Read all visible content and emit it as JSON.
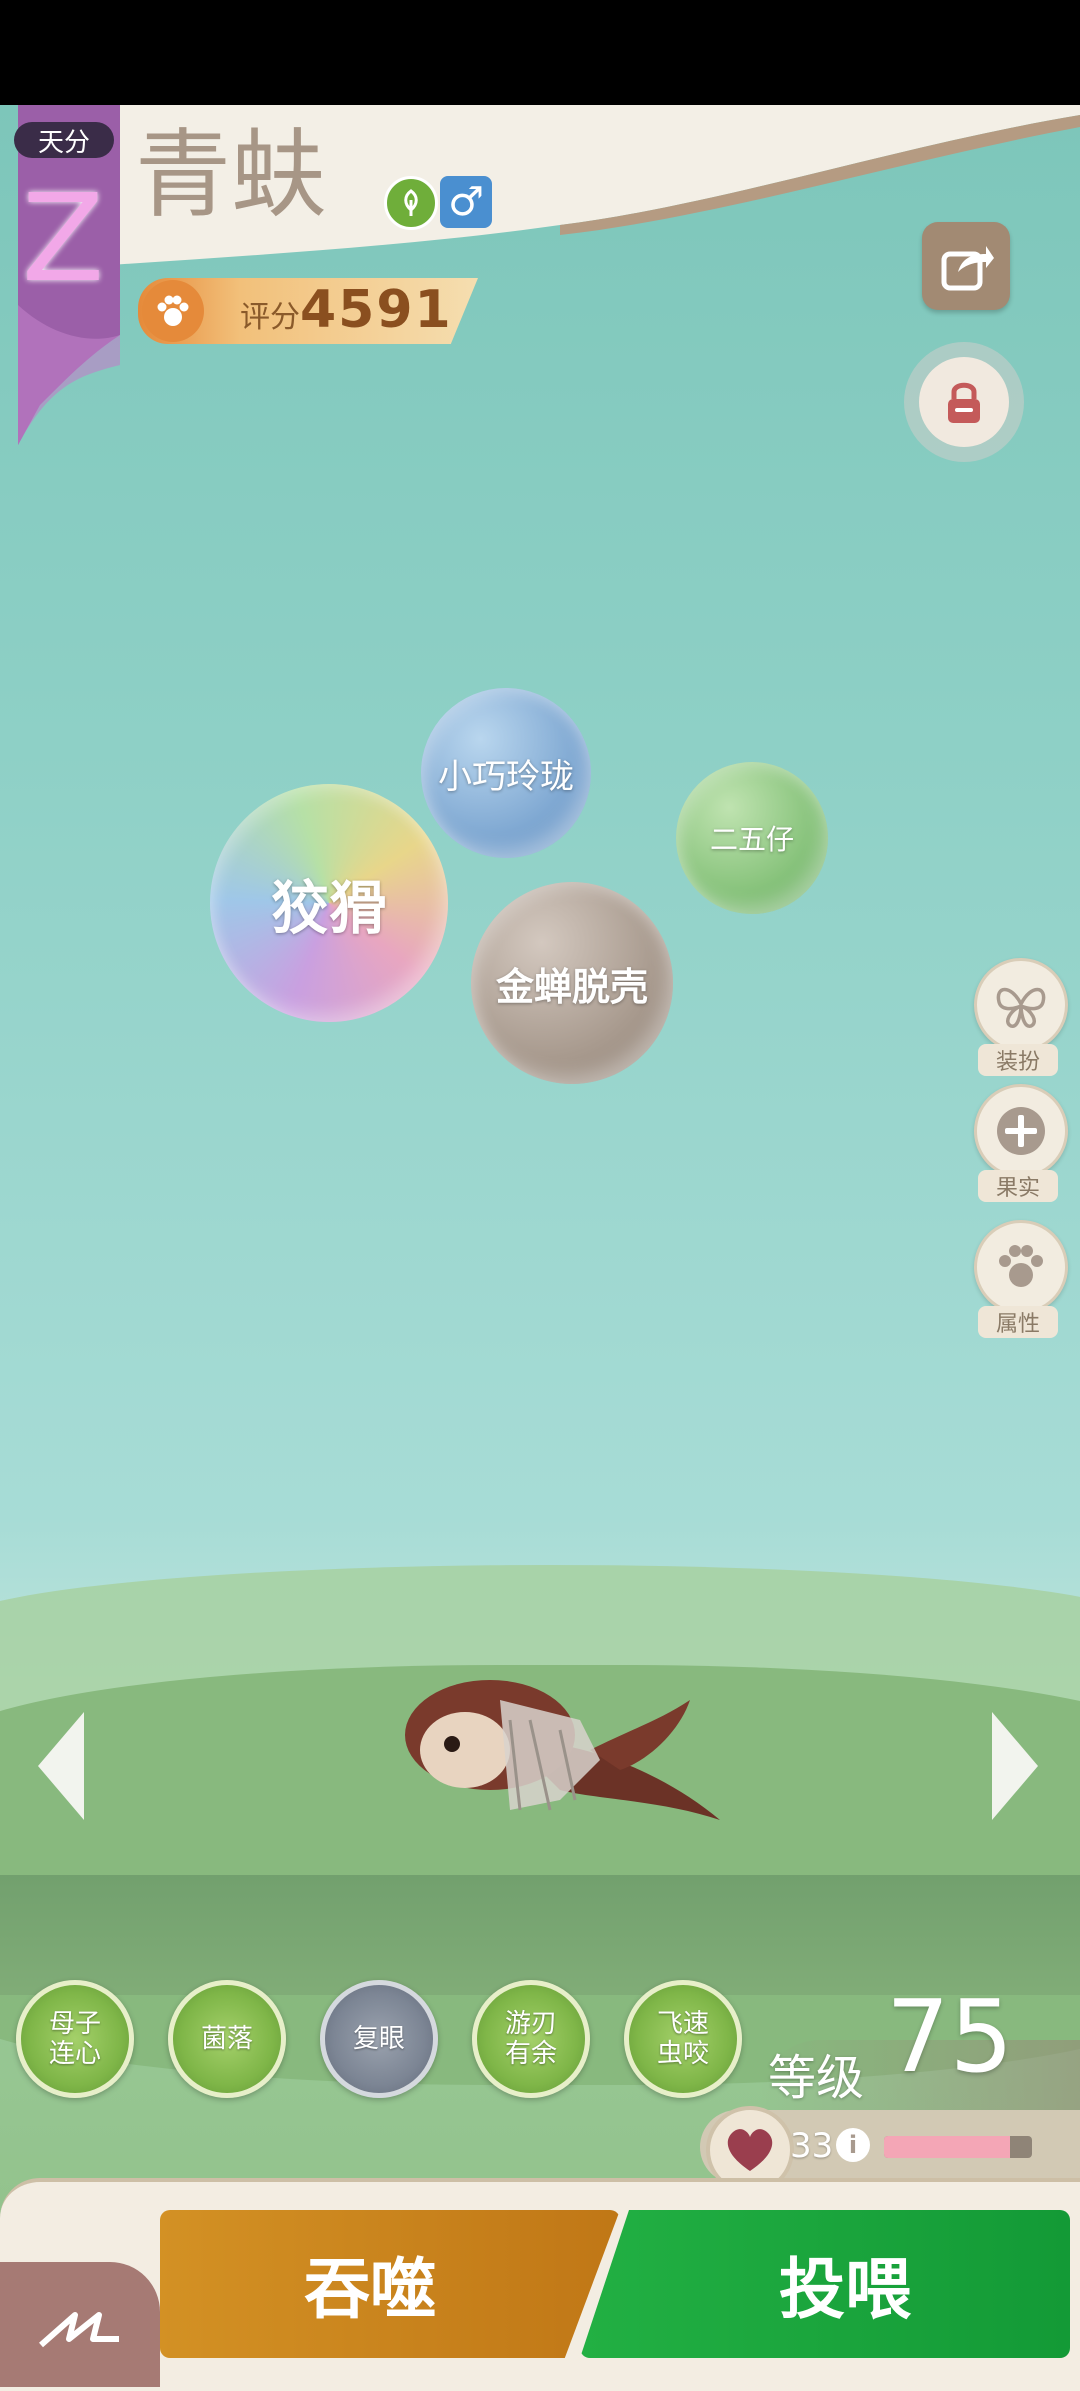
{
  "header": {
    "rank_label": "天分",
    "rank_grade": "Z",
    "pet_name": "青蚨",
    "element_icon": "grass-element-icon",
    "gender_symbol": "♂",
    "score_label": "评分",
    "score_value": "4591"
  },
  "traits": [
    {
      "label": "小巧玲珑",
      "color": "#7fa8d2"
    },
    {
      "label": "二五仔",
      "color": "#86c27a"
    },
    {
      "label": "狡猾",
      "color": "#c6b6d8"
    },
    {
      "label": "金蝉脱壳",
      "color": "#a89a8e"
    }
  ],
  "side_menu": [
    {
      "label": "装扮",
      "icon": "butterfly-icon"
    },
    {
      "label": "果实",
      "icon": "plus-icon"
    },
    {
      "label": "属性",
      "icon": "paw-icon"
    }
  ],
  "skills": [
    {
      "label": "母子\n连心"
    },
    {
      "label": "菌落"
    },
    {
      "label": "复眼"
    },
    {
      "label": "游刃\n有余"
    },
    {
      "label": "飞速\n虫咬"
    }
  ],
  "level": {
    "label": "等级",
    "value": "75"
  },
  "stamina": {
    "value": "33",
    "fill": 0.85
  },
  "actions": {
    "devour": "吞噬",
    "feed": "投喂"
  },
  "colors": {
    "devour": "#c9821a",
    "feed": "#1aa33a",
    "header_purple": "#9b5fa8"
  }
}
